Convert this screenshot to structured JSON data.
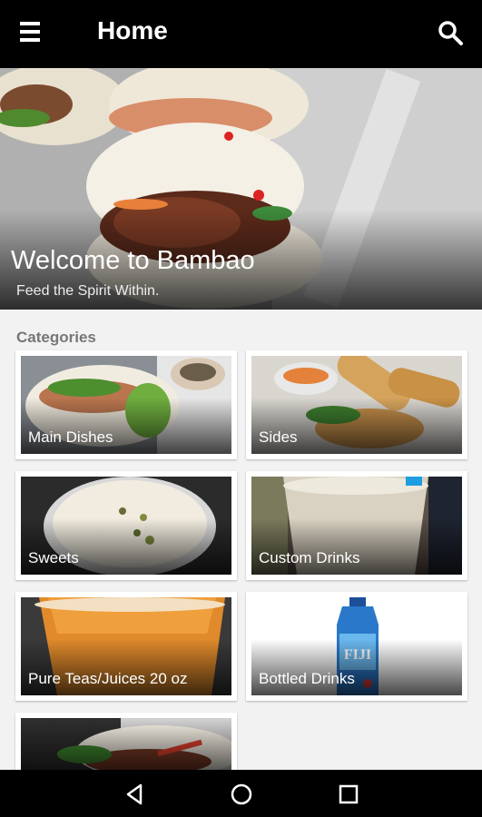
{
  "app_bar": {
    "title": "Home"
  },
  "hero": {
    "title": "Welcome to Bambao",
    "subtitle": "Feed the Spirit Within."
  },
  "categories": {
    "heading": "Categories",
    "items": [
      {
        "label": "Main Dishes"
      },
      {
        "label": "Sides"
      },
      {
        "label": "Sweets"
      },
      {
        "label": "Custom Drinks"
      },
      {
        "label": "Pure Teas/Juices 20 oz"
      },
      {
        "label": "Bottled Drinks"
      }
    ]
  },
  "icons": {
    "menu": "menu-icon",
    "search": "search-icon",
    "back": "back-icon",
    "home": "home-icon",
    "recents": "recents-icon"
  },
  "colors": {
    "app_bar": "#000000",
    "background": "#f2f2f2",
    "category_heading": "#777777",
    "fiji_blue": "#1e6fc2"
  }
}
